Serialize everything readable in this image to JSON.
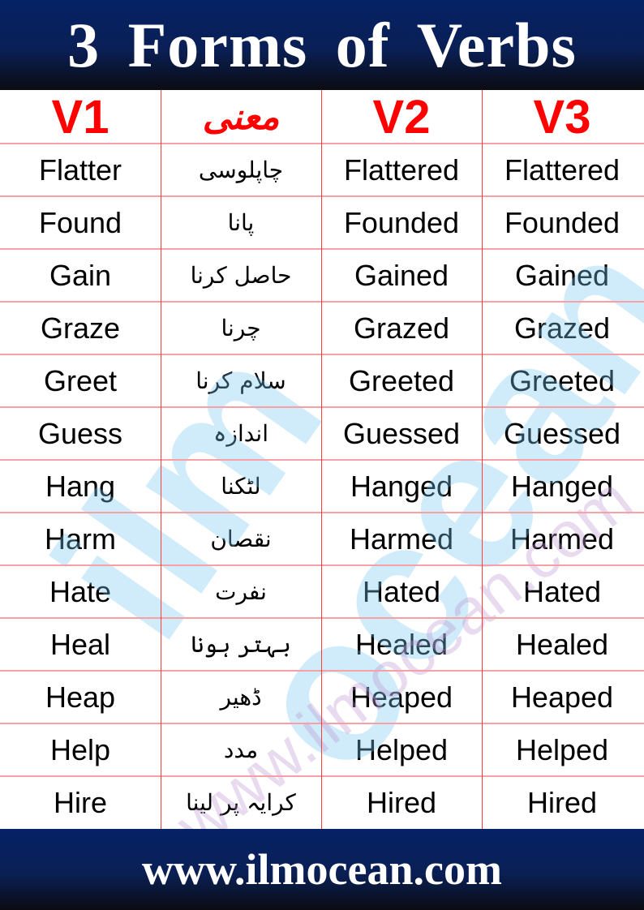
{
  "header": {
    "title": "3 Forms of Verbs"
  },
  "table": {
    "columns": [
      "V1",
      "معنی",
      "V2",
      "V3"
    ],
    "rows": [
      [
        "Flatter",
        "چاپلوسی",
        "Flattered",
        "Flattered"
      ],
      [
        "Found",
        "پانا",
        "Founded",
        "Founded"
      ],
      [
        "Gain",
        "حاصل کرنا",
        "Gained",
        "Gained"
      ],
      [
        "Graze",
        "چرنا",
        "Grazed",
        "Grazed"
      ],
      [
        "Greet",
        "سلام کرنا",
        "Greeted",
        "Greeted"
      ],
      [
        "Guess",
        "اندازہ",
        "Guessed",
        "Guessed"
      ],
      [
        "Hang",
        "لٹکنا",
        "Hanged",
        "Hanged"
      ],
      [
        "Harm",
        "نقصان",
        "Harmed",
        "Harmed"
      ],
      [
        "Hate",
        "نفرت",
        "Hated",
        "Hated"
      ],
      [
        "Heal",
        "بہتر ہونا",
        "Healed",
        "Healed"
      ],
      [
        "Heap",
        "ڈھیر",
        "Heaped",
        "Heaped"
      ],
      [
        "Help",
        "مدد",
        "Helped",
        "Helped"
      ],
      [
        "Hire",
        "کرایہ پر لینا",
        "Hired",
        "Hired"
      ]
    ]
  },
  "watermark": {
    "logo": "ilm ocean",
    "url": "www.ilmocean.com"
  },
  "footer": {
    "website": "www.ilmocean.com"
  },
  "colors": {
    "header_text": "#ff0000",
    "banner": "#052266",
    "grid": "#f7a0a6"
  }
}
